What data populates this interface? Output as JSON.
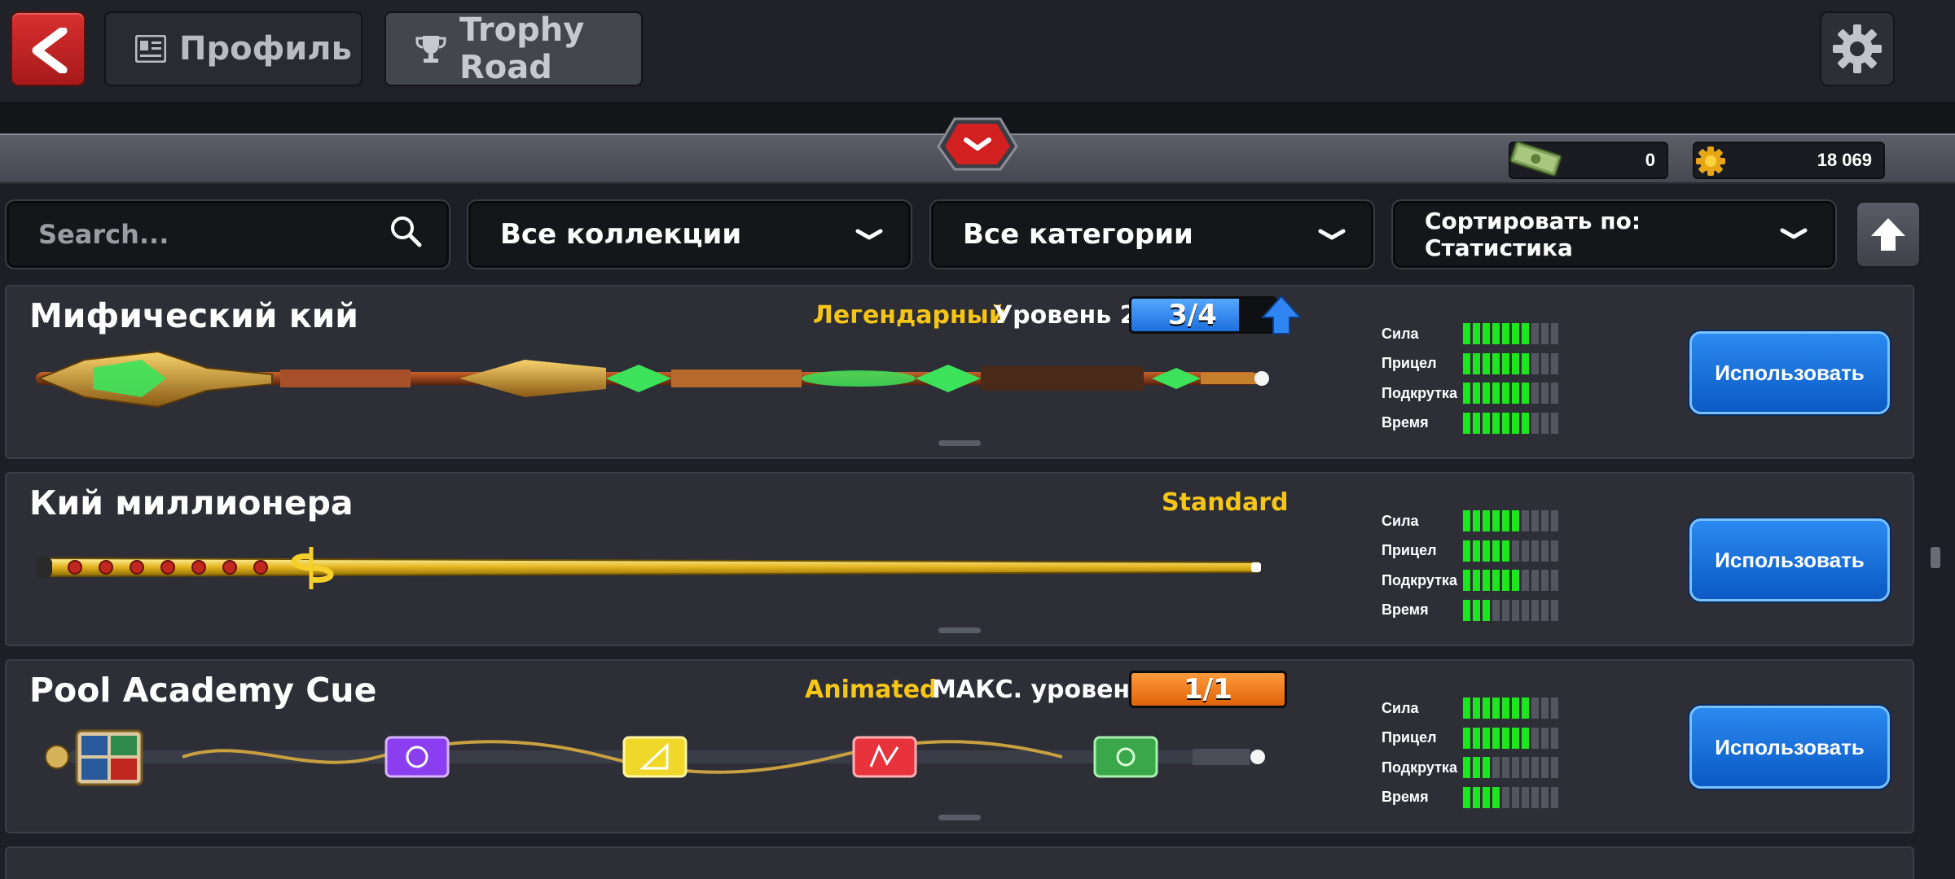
{
  "topbar": {
    "tab_profile": "Профиль",
    "tab_trophy": "Trophy Road"
  },
  "currency": {
    "cash": "0",
    "coins": "18 069"
  },
  "filters": {
    "search_placeholder": "Search...",
    "collections": "Все коллекции",
    "categories": "Все категории",
    "sort": "Сортировать по: Статистика"
  },
  "colors": {
    "rarity": "#f5c518",
    "stat_on": "#1ee61e",
    "use_button": "#1a74de",
    "level_bar_blue": "#2f86f2",
    "level_bar_orange": "#f07a14"
  },
  "stat_labels": [
    "Сила",
    "Прицел",
    "Подкрутка",
    "Время"
  ],
  "cues": [
    {
      "name": "Мифический кий",
      "rarity": "Легендарный",
      "level": "Уровень 2",
      "progress_text": "3/4",
      "progress_fraction": 0.75,
      "upgrade_available": true,
      "stats": [
        7,
        7,
        7,
        7
      ],
      "button": "Использовать"
    },
    {
      "name": "Кий миллионера",
      "rarity": "Standard",
      "level": "",
      "progress_text": "",
      "stats": [
        6,
        5,
        6,
        3
      ],
      "button": "Использовать"
    },
    {
      "name": "Pool Academy Cue",
      "rarity": "Animated",
      "level": "МАКС. уровень",
      "progress_text": "1/1",
      "progress_fraction": 1.0,
      "stats": [
        7,
        7,
        3,
        4
      ],
      "button": "Использовать"
    }
  ]
}
